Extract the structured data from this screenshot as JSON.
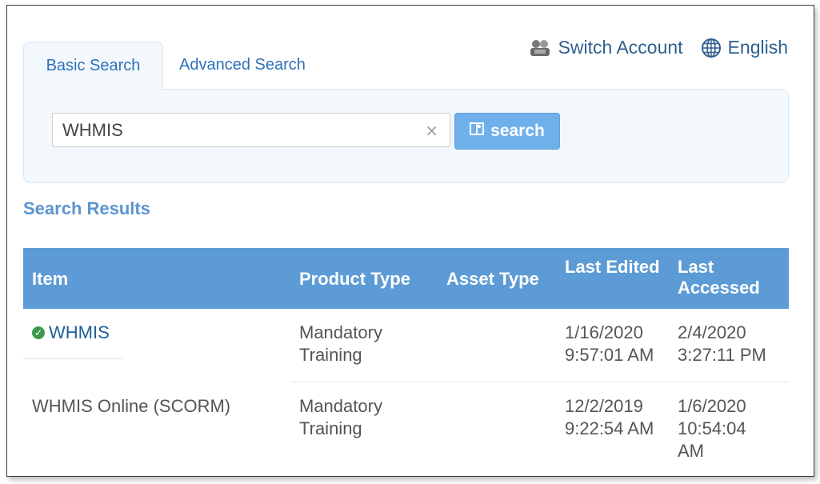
{
  "header": {
    "switch_account": "Switch Account",
    "language": "English"
  },
  "tabs": {
    "basic": "Basic Search",
    "advanced": "Advanced Search"
  },
  "search": {
    "value": "WHMIS",
    "clear_symbol": "×",
    "button_label": "search"
  },
  "results": {
    "heading": "Search Results",
    "columns": [
      "Item",
      "Product Type",
      "Asset Type",
      "Last Edited",
      "Last Accessed"
    ],
    "rows": [
      {
        "item": "WHMIS",
        "product_type": "Mandatory Training",
        "asset_type": "",
        "last_edited": "1/16/2020 9:57:01 AM",
        "last_accessed": "2/4/2020 3:27:11 PM"
      },
      {
        "item": "WHMIS Online (SCORM)",
        "product_type": "Mandatory Training",
        "asset_type": "",
        "last_edited": "12/2/2019 9:22:54 AM",
        "last_accessed": "1/6/2020 10:54:04 AM"
      }
    ]
  },
  "colors": {
    "header_bg": "#5c9bd6",
    "link": "#1e5f9c",
    "button": "#6fb0eb",
    "panel_bg": "#f3f8fd",
    "check": "#3b9a4c"
  }
}
